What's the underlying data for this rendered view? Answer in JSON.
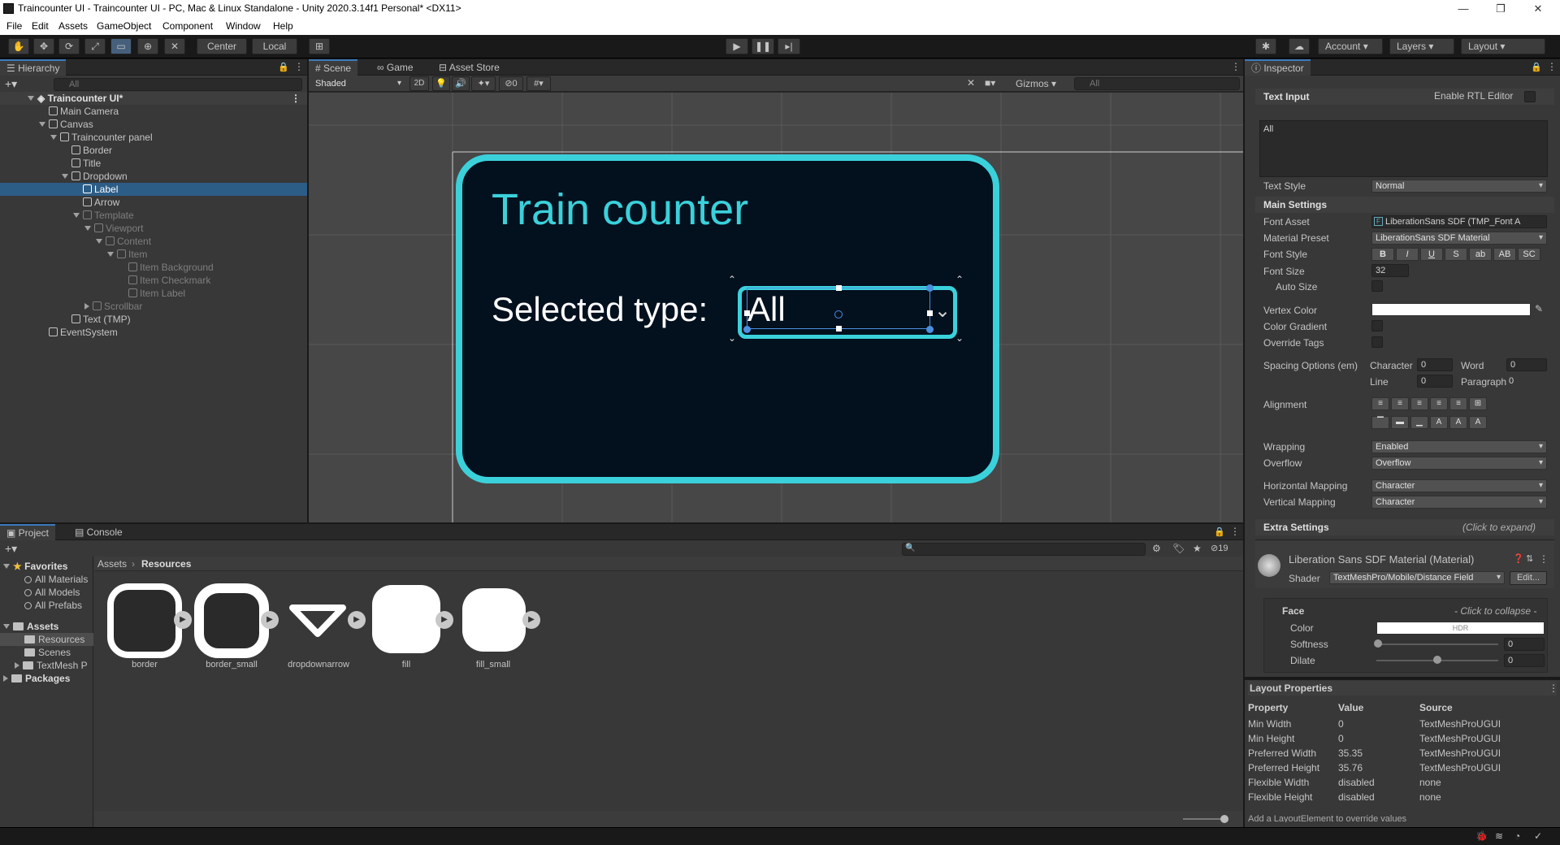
{
  "window": {
    "title": "Traincounter UI - Traincounter UI - PC, Mac & Linux Standalone - Unity 2020.3.14f1 Personal* <DX11>",
    "minimize": "—",
    "maximize": "❐",
    "close": "✕"
  },
  "menu": [
    "File",
    "Edit",
    "Assets",
    "GameObject",
    "Component",
    "Window",
    "Help"
  ],
  "toolbar": {
    "pivot_center": "Center",
    "pivot_local": "Local",
    "account": "Account",
    "layers": "Layers",
    "layout": "Layout"
  },
  "hierarchy": {
    "tab": "Hierarchy",
    "search_placeholder": "All",
    "scene": "Traincounter UI*",
    "items": [
      {
        "label": "Main Camera"
      },
      {
        "label": "Canvas"
      },
      {
        "label": "Traincounter panel"
      },
      {
        "label": "Border"
      },
      {
        "label": "Title"
      },
      {
        "label": "Dropdown"
      },
      {
        "label": "Label"
      },
      {
        "label": "Arrow"
      },
      {
        "label": "Template"
      },
      {
        "label": "Viewport"
      },
      {
        "label": "Content"
      },
      {
        "label": "Item"
      },
      {
        "label": "Item Background"
      },
      {
        "label": "Item Checkmark"
      },
      {
        "label": "Item Label"
      },
      {
        "label": "Scrollbar"
      },
      {
        "label": "Text (TMP)"
      },
      {
        "label": "EventSystem"
      }
    ]
  },
  "scene_view": {
    "tabs": [
      "Scene",
      "Game",
      "Asset Store"
    ],
    "shading": "Shaded",
    "mode_2d": "2D",
    "hidden_count": "0",
    "gizmos": "Gizmos",
    "search_placeholder": "All",
    "panel_title": "Train counter",
    "selected_label": "Selected type:",
    "dropdown_value": "All",
    "colors": {
      "border": "#3ad1db",
      "panel": "#03101e",
      "grid_bg": "#474747"
    }
  },
  "inspector": {
    "tab": "Inspector",
    "text_input": "Text Input",
    "enable_rtl": "Enable RTL Editor",
    "text_value": "All",
    "text_style_label": "Text Style",
    "text_style": "Normal",
    "main_settings": "Main Settings",
    "font_asset_label": "Font Asset",
    "font_asset": "LiberationSans SDF (TMP_Font A",
    "material_preset_label": "Material Preset",
    "material_preset": "LiberationSans SDF Material",
    "font_style_label": "Font Style",
    "font_styles": [
      "B",
      "I",
      "U",
      "S",
      "ab",
      "AB",
      "SC"
    ],
    "font_size_label": "Font Size",
    "font_size": "32",
    "auto_size": "Auto Size",
    "vertex_color": "Vertex Color",
    "color_gradient": "Color Gradient",
    "override_tags": "Override Tags",
    "spacing_label": "Spacing Options (em)",
    "character_label": "Character",
    "character": "0",
    "word_label": "Word",
    "word": "0",
    "line_label": "Line",
    "line": "0",
    "paragraph_label": "Paragraph",
    "paragraph": "0",
    "alignment_label": "Alignment",
    "wrapping_label": "Wrapping",
    "wrapping": "Enabled",
    "overflow_label": "Overflow",
    "overflow": "Overflow",
    "hmap_label": "Horizontal Mapping",
    "hmap": "Character",
    "vmap_label": "Vertical Mapping",
    "vmap": "Character",
    "extra_settings": "Extra Settings",
    "click_expand": "(Click to expand)",
    "material_name": "Liberation Sans SDF Material (Material)",
    "shader_label": "Shader",
    "shader": "TextMeshPro/Mobile/Distance Field",
    "edit": "Edit...",
    "face": "Face",
    "click_collapse": "- Click to collapse -",
    "color_label": "Color",
    "hdr": "HDR",
    "softness_label": "Softness",
    "softness": "0",
    "dilate_label": "Dilate",
    "dilate": "0"
  },
  "layout_properties": {
    "title": "Layout Properties",
    "headers": [
      "Property",
      "Value",
      "Source"
    ],
    "rows": [
      [
        "Min Width",
        "0",
        "TextMeshProUGUI"
      ],
      [
        "Min Height",
        "0",
        "TextMeshProUGUI"
      ],
      [
        "Preferred Width",
        "35.35",
        "TextMeshProUGUI"
      ],
      [
        "Preferred Height",
        "35.76",
        "TextMeshProUGUI"
      ],
      [
        "Flexible Width",
        "disabled",
        "none"
      ],
      [
        "Flexible Height",
        "disabled",
        "none"
      ]
    ],
    "footer": "Add a LayoutElement to override values"
  },
  "project": {
    "tabs": [
      "Project",
      "Console"
    ],
    "hidden_count": "19",
    "favorites": "Favorites",
    "fav_items": [
      "All Materials",
      "All Models",
      "All Prefabs"
    ],
    "assets": "Assets",
    "asset_folders": [
      "Resources",
      "Scenes",
      "TextMesh P"
    ],
    "packages": "Packages",
    "breadcrumb_root": "Assets",
    "breadcrumb_current": "Resources",
    "files": [
      "border",
      "border_small",
      "dropdownarrow",
      "fill",
      "fill_small"
    ]
  }
}
